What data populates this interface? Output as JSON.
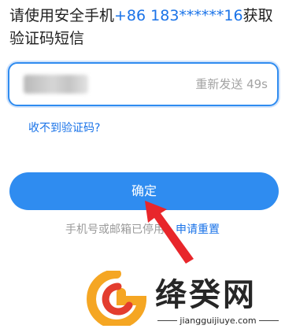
{
  "prompt": {
    "prefix": "请使用安全手机",
    "phone": "+86 183******16",
    "suffix": "获取验证码短信"
  },
  "code_input": {
    "value_obscured": true,
    "resend_label": "重新发送 49s"
  },
  "help_link": "收不到验证码?",
  "confirm_button": "确定",
  "reset": {
    "text_visible": "手机号或邮箱已停用",
    "link_visible": "申请重置"
  },
  "watermark": {
    "title": "绛癸网",
    "url": "jiangguijiuye.com"
  },
  "colors": {
    "accent": "#2f8cf0",
    "link": "#1a73e8",
    "arrow": "#e8262b",
    "logo_orange": "#f5a623",
    "logo_red": "#e33d2e"
  },
  "icons": {
    "annotation": "red-arrow-icon",
    "logo": "jianggui-logo-icon"
  }
}
